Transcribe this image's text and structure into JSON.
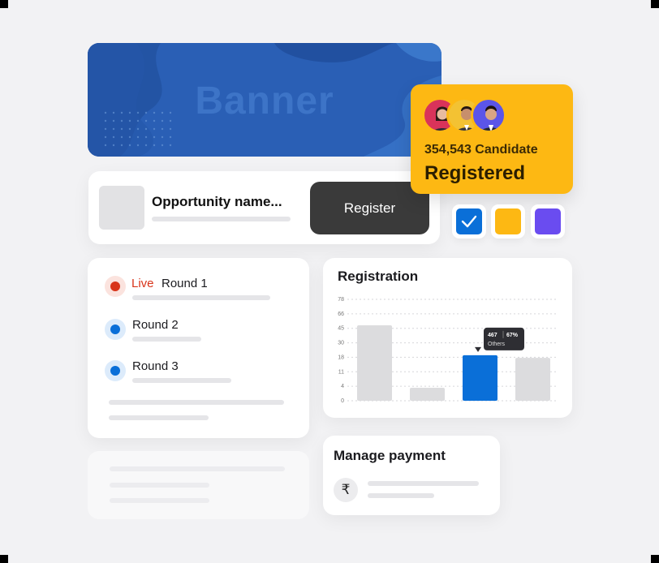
{
  "banner": {
    "text": "Banner"
  },
  "opportunity": {
    "title": "Opportunity name...",
    "button_label": "Register"
  },
  "registered_badge": {
    "count_text": "354,543 Candidate",
    "label": "Registered"
  },
  "swatches": [
    {
      "name": "checked",
      "color": "#0a6fd8"
    },
    {
      "name": "yellow",
      "color": "#fdb813"
    },
    {
      "name": "purple",
      "color": "#6a4cf0"
    }
  ],
  "rounds": [
    {
      "status": "Live",
      "label": "Round 1",
      "dot_color": "#d8341a"
    },
    {
      "status": "",
      "label": "Round 2",
      "dot_color": "#0a6fd8"
    },
    {
      "status": "",
      "label": "Round 3",
      "dot_color": "#0a6fd8"
    }
  ],
  "registration": {
    "title": "Registration"
  },
  "chart_data": {
    "type": "bar",
    "title": "Registration",
    "y_ticks": [
      "78",
      "66",
      "45",
      "30",
      "18",
      "11",
      "4",
      "0"
    ],
    "values": [
      58,
      10,
      35,
      33
    ],
    "highlight_index": 2,
    "colors": {
      "default": "#dcdcde",
      "highlight": "#0a6fd8"
    },
    "tooltip": {
      "value": "467",
      "percent": "67%",
      "label": "Others"
    }
  },
  "payment": {
    "title": "Manage payment",
    "icon": "rupee-icon",
    "symbol": "₹"
  }
}
